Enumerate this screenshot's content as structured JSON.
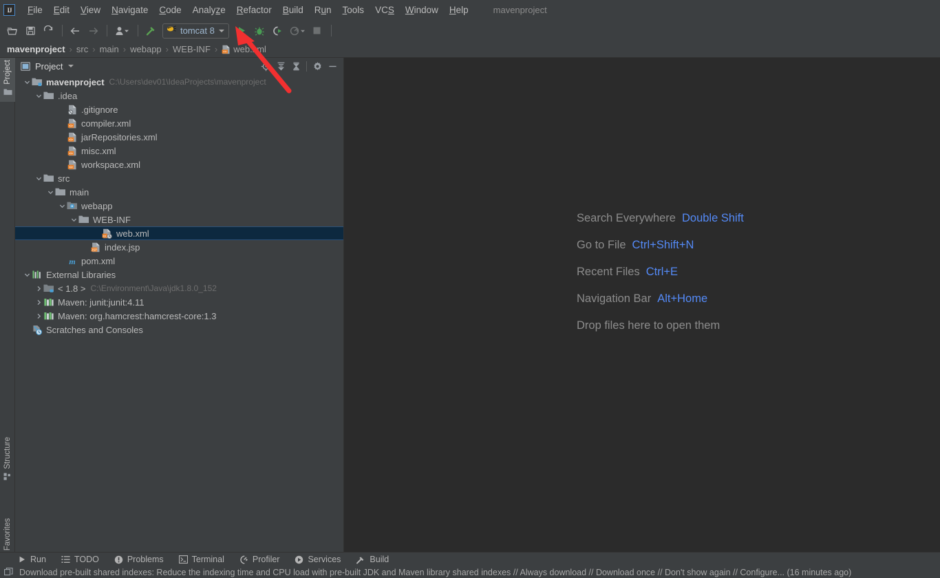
{
  "window": {
    "title": "mavenproject"
  },
  "menubar": {
    "logo_icon": "intellij-idea-logo",
    "items": [
      {
        "label": "File",
        "mnemonic": "F"
      },
      {
        "label": "Edit",
        "mnemonic": "E"
      },
      {
        "label": "View",
        "mnemonic": "V"
      },
      {
        "label": "Navigate",
        "mnemonic": "N"
      },
      {
        "label": "Code",
        "mnemonic": "C"
      },
      {
        "label": "Analyze",
        "mnemonic": "z"
      },
      {
        "label": "Refactor",
        "mnemonic": "R"
      },
      {
        "label": "Build",
        "mnemonic": "B"
      },
      {
        "label": "Run",
        "mnemonic": "u"
      },
      {
        "label": "Tools",
        "mnemonic": "T"
      },
      {
        "label": "VCS",
        "mnemonic": "S"
      },
      {
        "label": "Window",
        "mnemonic": "W"
      },
      {
        "label": "Help",
        "mnemonic": "H"
      }
    ]
  },
  "toolbar": {
    "open_icon": "open-folder-icon",
    "save_icon": "save-icon",
    "sync_icon": "refresh-icon",
    "back_icon": "arrow-left-icon",
    "forward_icon": "arrow-right-icon",
    "profile_icon": "user-profile-icon",
    "build_icon": "hammer-icon",
    "run_config": {
      "label": "tomcat 8",
      "icon": "tomcat-icon"
    },
    "run_icon": "run-play-icon",
    "debug_icon": "debug-bug-icon",
    "run_coverage_icon": "run-with-coverage-icon",
    "profile_run_icon": "profiler-run-icon",
    "stop_icon": "stop-square-icon"
  },
  "breadcrumb": {
    "items": [
      "mavenproject",
      "src",
      "main",
      "webapp",
      "WEB-INF",
      "web.xml"
    ],
    "separator": "›",
    "file_icon": "xml-file-icon"
  },
  "left_stripe": {
    "tabs": [
      {
        "label": "Project",
        "icon": "project-panel-icon",
        "active": true
      },
      {
        "label": "Structure",
        "icon": "structure-icon",
        "active": false
      },
      {
        "label": "Favorites",
        "icon": "star-icon",
        "active": false
      }
    ]
  },
  "project_panel": {
    "title": "Project",
    "title_icon": "project-view-icon",
    "dropdown_icon": "chevron-down-icon",
    "tools": [
      {
        "name": "select-opened-file-icon"
      },
      {
        "name": "expand-all-icon"
      },
      {
        "name": "collapse-all-icon"
      },
      {
        "name": "settings-gear-icon"
      },
      {
        "name": "hide-minimize-icon"
      }
    ],
    "tree": [
      {
        "label": "mavenproject",
        "path": "C:\\Users\\dev01\\IdeaProjects\\mavenproject",
        "depth": 0,
        "chevron": "down",
        "icon": "module-folder-icon",
        "bold": true,
        "selected": false
      },
      {
        "label": ".idea",
        "depth": 1,
        "chevron": "down",
        "icon": "folder-icon",
        "bold": false,
        "selected": false
      },
      {
        "label": ".gitignore",
        "depth": 3,
        "chevron": "none",
        "icon": "gitignore-file-icon",
        "bold": false,
        "selected": false
      },
      {
        "label": "compiler.xml",
        "depth": 3,
        "chevron": "none",
        "icon": "xml-file-icon",
        "bold": false,
        "selected": false
      },
      {
        "label": "jarRepositories.xml",
        "depth": 3,
        "chevron": "none",
        "icon": "xml-file-icon",
        "bold": false,
        "selected": false
      },
      {
        "label": "misc.xml",
        "depth": 3,
        "chevron": "none",
        "icon": "xml-file-icon",
        "bold": false,
        "selected": false
      },
      {
        "label": "workspace.xml",
        "depth": 3,
        "chevron": "none",
        "icon": "xml-file-icon",
        "bold": false,
        "selected": false
      },
      {
        "label": "src",
        "depth": 1,
        "chevron": "down",
        "icon": "folder-icon",
        "bold": false,
        "selected": false
      },
      {
        "label": "main",
        "depth": 2,
        "chevron": "down",
        "icon": "folder-icon",
        "bold": false,
        "selected": false
      },
      {
        "label": "webapp",
        "depth": 3,
        "chevron": "down",
        "icon": "webapp-folder-icon",
        "bold": false,
        "selected": false
      },
      {
        "label": "WEB-INF",
        "depth": 4,
        "chevron": "down",
        "icon": "folder-icon",
        "bold": false,
        "selected": false
      },
      {
        "label": "web.xml",
        "depth": 6,
        "chevron": "none",
        "icon": "web-xml-file-icon",
        "bold": false,
        "selected": true
      },
      {
        "label": "index.jsp",
        "depth": 5,
        "chevron": "none",
        "icon": "jsp-file-icon",
        "bold": false,
        "selected": false
      },
      {
        "label": "pom.xml",
        "depth": 3,
        "chevron": "none",
        "icon": "maven-pom-icon",
        "bold": false,
        "selected": false
      },
      {
        "label": "External Libraries",
        "depth": 0,
        "chevron": "down",
        "icon": "external-libraries-icon",
        "bold": false,
        "selected": false
      },
      {
        "label": "< 1.8 >",
        "path": "C:\\Environment\\Java\\jdk1.8.0_152",
        "depth": 1,
        "chevron": "right",
        "icon": "jdk-icon",
        "bold": false,
        "selected": false
      },
      {
        "label": "Maven: junit:junit:4.11",
        "depth": 1,
        "chevron": "right",
        "icon": "library-icon",
        "bold": false,
        "selected": false
      },
      {
        "label": "Maven: org.hamcrest:hamcrest-core:1.3",
        "depth": 1,
        "chevron": "right",
        "icon": "library-icon",
        "bold": false,
        "selected": false
      },
      {
        "label": "Scratches and Consoles",
        "depth": 0,
        "chevron": "none",
        "icon": "scratches-icon",
        "bold": false,
        "selected": false
      }
    ]
  },
  "editor": {
    "hints": [
      {
        "label": "Search Everywhere",
        "key": "Double Shift"
      },
      {
        "label": "Go to File",
        "key": "Ctrl+Shift+N"
      },
      {
        "label": "Recent Files",
        "key": "Ctrl+E"
      },
      {
        "label": "Navigation Bar",
        "key": "Alt+Home"
      },
      {
        "label": "Drop files here to open them",
        "key": ""
      }
    ]
  },
  "bottom_bar": {
    "items": [
      {
        "label": "Run",
        "icon": "run-play-icon"
      },
      {
        "label": "TODO",
        "icon": "todo-list-icon"
      },
      {
        "label": "Problems",
        "icon": "problems-warning-icon"
      },
      {
        "label": "Terminal",
        "icon": "terminal-icon"
      },
      {
        "label": "Profiler",
        "icon": "profiler-icon"
      },
      {
        "label": "Services",
        "icon": "services-icon"
      },
      {
        "label": "Build",
        "icon": "build-hammer-icon"
      }
    ]
  },
  "status_bar": {
    "icon": "notification-icon",
    "message": "Download pre-built shared indexes: Reduce the indexing time and CPU load with pre-built JDK and Maven library shared indexes // Always download // Download once // Don't show again // Configure... (16 minutes ago)"
  },
  "annotation": {
    "arrow_color": "#f23030",
    "points_to": "run-button"
  },
  "colors": {
    "chrome": "#3c3f41",
    "editor_bg": "#2b2b2b",
    "selection": "#0d293f",
    "accent_link": "#548af7",
    "run_green": "#4caf50",
    "xml_orange": "#e8802a"
  }
}
